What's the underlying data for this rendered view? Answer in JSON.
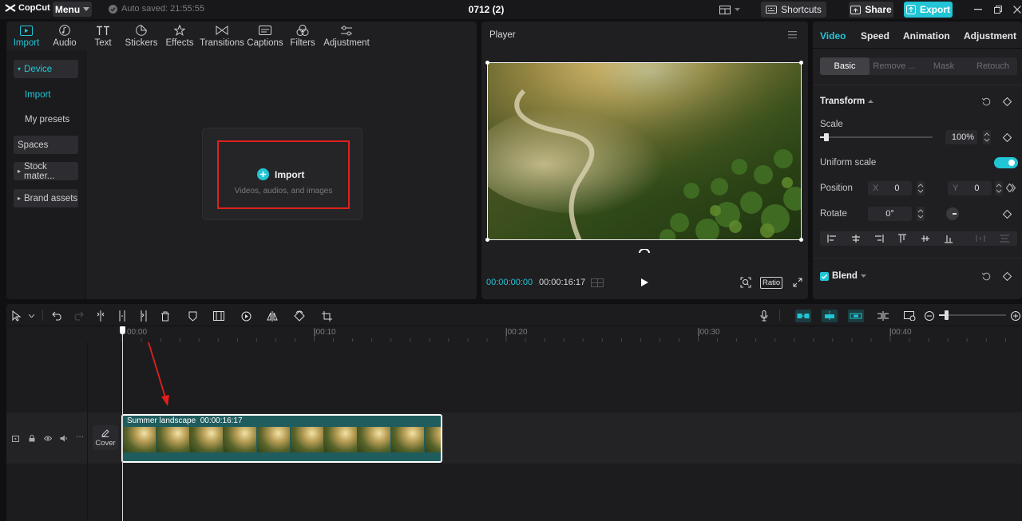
{
  "app": {
    "logo_text": "CopCut",
    "menu_label": "Menu",
    "autosave_text": "Auto saved: 21:55:55",
    "project_title": "0712 (2)",
    "shortcuts_label": "Shortcuts",
    "share_label": "Share",
    "export_label": "Export"
  },
  "media_panel": {
    "tabs": [
      {
        "label": "Import",
        "icon": "import-icon",
        "active": true
      },
      {
        "label": "Audio",
        "icon": "audio-icon"
      },
      {
        "label": "Text",
        "icon": "text-icon"
      },
      {
        "label": "Stickers",
        "icon": "stickers-icon"
      },
      {
        "label": "Effects",
        "icon": "effects-icon"
      },
      {
        "label": "Transitions",
        "icon": "transitions-icon"
      },
      {
        "label": "Captions",
        "icon": "captions-icon"
      },
      {
        "label": "Filters",
        "icon": "filters-icon"
      },
      {
        "label": "Adjustment",
        "icon": "adjustment-icon"
      }
    ],
    "sidebar": {
      "device": "Device",
      "import": "Import",
      "my_presets": "My presets",
      "spaces": "Spaces",
      "stock": "Stock mater...",
      "brand": "Brand assets"
    },
    "import_box": {
      "title": "Import",
      "subtitle": "Videos, audios, and images"
    }
  },
  "player": {
    "title": "Player",
    "current_time": "00:00:00:00",
    "total_time": "00:00:16:17",
    "ratio_label": "Ratio"
  },
  "inspector": {
    "tabs": [
      "Video",
      "Speed",
      "Animation",
      "Adjustment"
    ],
    "sub_tabs": [
      "Basic",
      "Remove ...",
      "Mask",
      "Retouch"
    ],
    "transform_title": "Transform",
    "scale_label": "Scale",
    "scale_value": "100%",
    "scale_fraction": 0.06,
    "uniform_scale_label": "Uniform scale",
    "uniform_scale_on": true,
    "position_label": "Position",
    "pos_x_label": "X",
    "pos_x_value": "0",
    "pos_y_label": "Y",
    "pos_y_value": "0",
    "rotate_label": "Rotate",
    "rotate_value": "0°",
    "blend_label": "Blend"
  },
  "timeline": {
    "ticks": [
      "00:00",
      "|00:10",
      "|00:20",
      "|00:30",
      "|00:40"
    ],
    "clip_name": "Summer landscape",
    "clip_duration": "00:00:16:17",
    "cover_label": "Cover"
  },
  "colors": {
    "accent": "#22c5d5",
    "clip": "#1f5c5e",
    "highlight_box": "#e0201c"
  }
}
